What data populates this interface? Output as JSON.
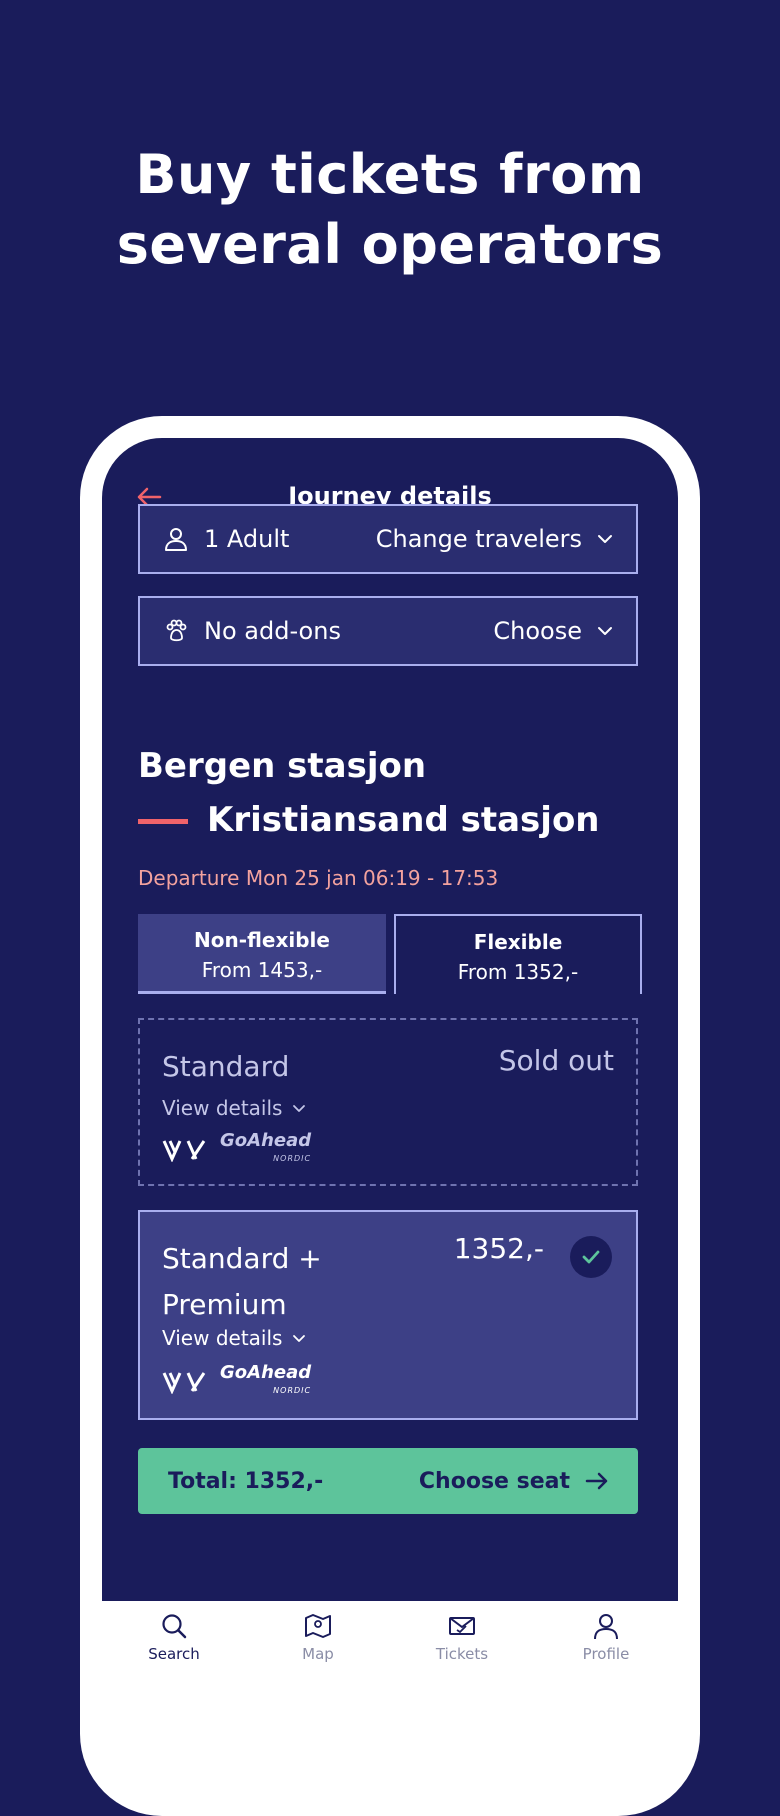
{
  "headline": {
    "line1": "Buy tickets from",
    "line2": "several operators"
  },
  "header": {
    "title": "Journey details"
  },
  "travelers": {
    "value": "1 Adult",
    "action": "Change travelers"
  },
  "addons": {
    "value": "No add-ons",
    "action": "Choose"
  },
  "route": {
    "from": "Bergen stasjon",
    "to": "Kristiansand stasjon",
    "departure": "Departure Mon 25 jan 06:19 - 17:53"
  },
  "fare_tabs": [
    {
      "title": "Non-flexible",
      "price": "From 1453,-"
    },
    {
      "title": "Flexible",
      "price": "From 1352,-"
    }
  ],
  "options": [
    {
      "name": "Standard",
      "status": "Sold out",
      "details": "View details",
      "operators": [
        "Vy",
        "GoAhead",
        "NORDIC"
      ]
    },
    {
      "name_line1": "Standard +",
      "name_line2": "Premium",
      "price": "1352,-",
      "details": "View details",
      "operators": [
        "Vy",
        "GoAhead",
        "NORDIC"
      ]
    }
  ],
  "cta": {
    "total": "Total: 1352,-",
    "action": "Choose seat"
  },
  "tabbar": [
    {
      "label": "Search",
      "icon": "search-icon"
    },
    {
      "label": "Map",
      "icon": "map-icon"
    },
    {
      "label": "Tickets",
      "icon": "ticket-icon"
    },
    {
      "label": "Profile",
      "icon": "profile-icon"
    }
  ],
  "colors": {
    "background": "#1a1c5b",
    "accent_green": "#5dc49b",
    "accent_red": "#f0636a"
  }
}
